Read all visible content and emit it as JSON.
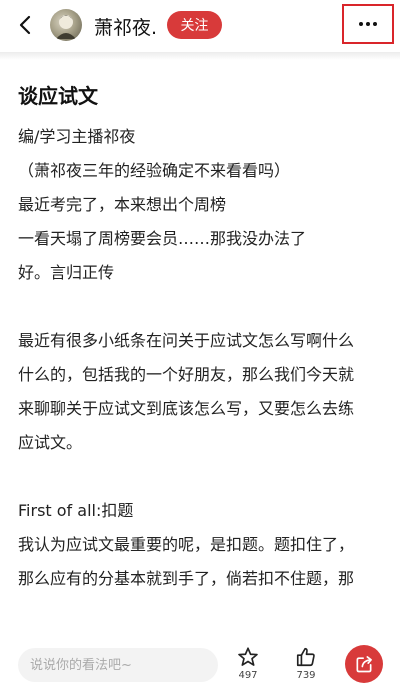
{
  "header": {
    "username": "萧祁夜.",
    "follow_label": "关注"
  },
  "article": {
    "title": "谈应试文",
    "lines_a": [
      "编/学习主播祁夜",
      "（萧祁夜三年的经验确定不来看看吗）",
      "最近考完了，本来想出个周榜",
      "一看天塌了周榜要会员……那我没办法了",
      "好。言归正传"
    ],
    "lines_b": [
      "最近有很多小纸条在问关于应试文怎么写啊什么",
      "什么的，包括我的一个好朋友，那么我们今天就",
      "来聊聊关于应试文到底该怎么写，又要怎么去练",
      "应试文。"
    ],
    "lines_c": [
      "First of all:扣题",
      "我认为应试文最重要的呢，是扣题。题扣住了，",
      "那么应有的分基本就到手了，倘若扣不住题，那"
    ]
  },
  "bottom": {
    "comment_placeholder": "说说你的看法吧~",
    "star_count": "497",
    "like_count": "739"
  },
  "colors": {
    "accent": "#d83a3a",
    "highlight_border": "#d9252a"
  },
  "icons": {
    "back": "back-arrow-icon",
    "more": "more-dots-icon",
    "star": "star-icon",
    "like": "thumbs-up-icon",
    "share": "share-icon"
  }
}
